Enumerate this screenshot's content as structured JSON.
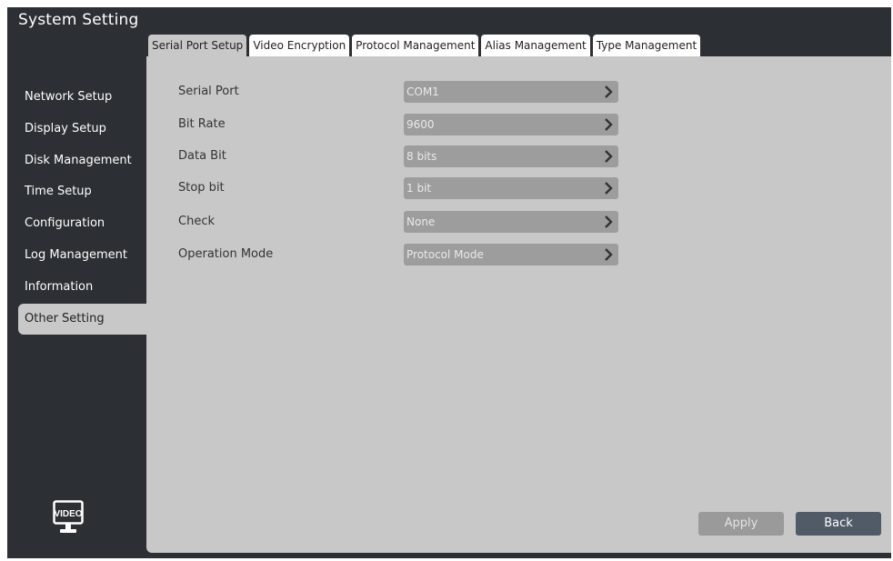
{
  "window": {
    "title": "System Setting"
  },
  "tabs": [
    {
      "label": "Serial Port Setup",
      "active": true
    },
    {
      "label": "Video Encryption",
      "active": false
    },
    {
      "label": "Protocol Management",
      "active": false
    },
    {
      "label": "Alias Management",
      "active": false
    },
    {
      "label": "Type Management",
      "active": false
    }
  ],
  "sidebar": {
    "items": [
      {
        "label": "Network Setup"
      },
      {
        "label": "Display Setup"
      },
      {
        "label": "Disk Management"
      },
      {
        "label": "Time Setup"
      },
      {
        "label": "Configuration"
      },
      {
        "label": "Log Management"
      },
      {
        "label": "Information"
      },
      {
        "label": "Other Setting",
        "active": true
      }
    ],
    "logo_text": "VIDEO"
  },
  "form": {
    "rows": [
      {
        "label": "Serial Port",
        "value": "COM1"
      },
      {
        "label": "Bit Rate",
        "value": "9600"
      },
      {
        "label": "Data Bit",
        "value": "8 bits"
      },
      {
        "label": "Stop bit",
        "value": "1 bit"
      },
      {
        "label": "Check",
        "value": "None"
      },
      {
        "label": "Operation Mode",
        "value": "Protocol Mode"
      }
    ]
  },
  "buttons": {
    "apply": "Apply",
    "back": "Back"
  },
  "icons": {
    "dropdown": "chevron-right-icon",
    "logo": "video-monitor-icon"
  },
  "colors": {
    "background": "#2c2f33",
    "panel": "#c8c8c8",
    "field": "#9d9d9d",
    "back_button": "#505b67"
  }
}
